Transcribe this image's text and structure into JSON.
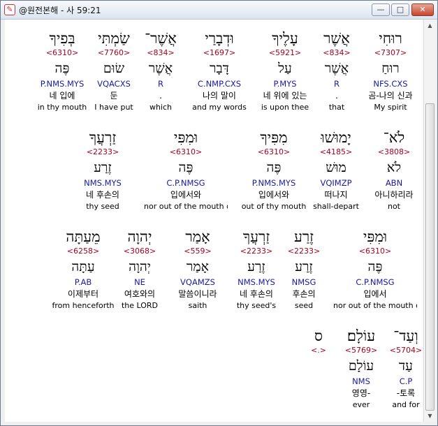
{
  "window": {
    "title": "@원전본해 - 사 59:21",
    "icon": "bible-app-icon",
    "controls": {
      "min": "—",
      "max": "□",
      "close": "✕"
    }
  },
  "rows": [
    {
      "words": [
        {
          "heb": "רוּחִי",
          "strong": "<7307>",
          "lemma": "רוּחַ",
          "morph": "NFS.CXS",
          "ko": "곰-나의 신과",
          "en": "My spirit"
        },
        {
          "heb": "אֲשֶׁר",
          "strong": "<834>",
          "lemma": "אֲשֶׁר",
          "morph": "R",
          "ko": ".",
          "en": "that"
        },
        {
          "heb": "עָלֶיךָ",
          "strong": "<5921>",
          "lemma": "עַל",
          "morph": "P.MYS",
          "ko": "네 위에 있는",
          "en": "is upon thee"
        },
        {
          "heb": "וּדְבָרַי",
          "strong": "<1697>",
          "lemma": "דָּבָר",
          "morph": "C.NMP.CXS",
          "ko": "나의 말이",
          "en": "and my words"
        },
        {
          "heb": "אֲשֶׁר־",
          "strong": "<834>",
          "lemma": "אֲשֶׁר",
          "morph": "R",
          "ko": ".",
          "en": "which"
        },
        {
          "heb": "שַׂמְתִּי",
          "strong": "<7760>",
          "lemma": "שׂוּם",
          "morph": "VQACXS",
          "ko": "둔",
          "en": "I have put"
        },
        {
          "heb": "בְּפִיךָ",
          "strong": "<6310>",
          "lemma": "פֶּה",
          "morph": "P.NMS.MYS",
          "ko": "네 입에",
          "en": "in thy mouth"
        }
      ]
    },
    {
      "words": [
        {
          "heb": "לֹא־",
          "strong": "<3808>",
          "lemma": "לֹא",
          "morph": "ABN",
          "ko": "아니하리라",
          "en": "not"
        },
        {
          "heb": "יָמוּשׁוּ",
          "strong": "<4185>",
          "lemma": "מוּשׁ",
          "morph": "VQIMZP",
          "ko": "떠나지",
          "en": "shall-depart"
        },
        {
          "heb": "מִפִּיךָ",
          "strong": "<6310>",
          "lemma": "פֶּה",
          "morph": "P.NMS.MYS",
          "ko": "입에서와",
          "en": "out of thy mouth"
        },
        {
          "heb": "וּמִפִּי",
          "strong": "<6310>",
          "lemma": "פֶּה",
          "morph": "C.P.NMSG",
          "ko": "입에서와",
          "en": "nor out of the mouth of"
        },
        {
          "heb": "זַרְעֲךָ",
          "strong": "<2233>",
          "lemma": "זֶרַע",
          "morph": "NMS.MYS",
          "ko": "네 후손의",
          "en": "thy seed"
        }
      ]
    },
    {
      "words": [
        {
          "heb": "וּמִפִּי",
          "strong": "<6310>",
          "lemma": "פֶּה",
          "morph": "C.P.NMSG",
          "ko": "입에서",
          "en": "nor out of the mouth of"
        },
        {
          "heb": "זֶרַע",
          "strong": "<2233>",
          "lemma": "זֶרַע",
          "morph": "NMSG",
          "ko": "후손의",
          "en": "seed"
        },
        {
          "heb": "זַרְעֲךָ",
          "strong": "<2233>",
          "lemma": "זֶרַע",
          "morph": "NMS.MYS",
          "ko": "네 후손의",
          "en": "thy seed's"
        },
        {
          "heb": "אָמַר",
          "strong": "<559>",
          "lemma": "אָמַר",
          "morph": "VQAMZS",
          "ko": "말씀이니라",
          "en": "saith"
        },
        {
          "heb": "יְהוָה",
          "strong": "<3068>",
          "lemma": "יְהוָה",
          "morph": "NE",
          "ko": "여호와의",
          "en": "the LORD"
        },
        {
          "heb": "מֵעַתָּה",
          "strong": "<6258>",
          "lemma": "עַתָּה",
          "morph": "P.AB",
          "ko": "이제부터",
          "en": "from henceforth"
        }
      ]
    },
    {
      "words": [
        {
          "heb": "וְעַד־",
          "strong": "<5704>",
          "lemma": "עַד",
          "morph": "C.P",
          "ko": "-토록",
          "en": "and for"
        },
        {
          "heb": "עוֹלָם׃",
          "strong": "<5769>",
          "lemma": "עוֹלָם",
          "morph": "NMS",
          "ko": "영영-",
          "en": "ever"
        },
        {
          "heb": "ס",
          "strong": "<.>",
          "lemma": "",
          "morph": "",
          "ko": "",
          "en": ""
        }
      ]
    }
  ]
}
